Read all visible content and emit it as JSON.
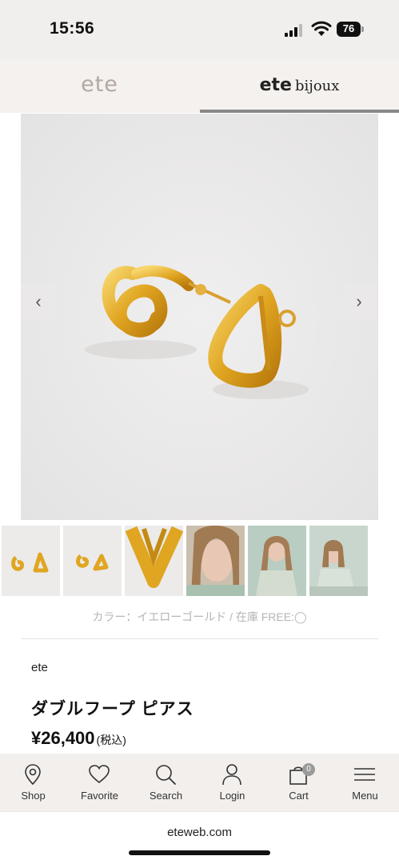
{
  "status": {
    "time": "15:56",
    "battery": "76"
  },
  "brand_tabs": [
    {
      "label": "ete"
    },
    {
      "label": "ete",
      "sub": "bijoux"
    }
  ],
  "carousel": {
    "prev_icon": "chevron-left-icon",
    "next_icon": "chevron-right-icon"
  },
  "variant_info": "カラー：イエローゴールド / 在庫 FREE:◯",
  "product": {
    "brand": "ete",
    "name": "ダブルフープ ピアス",
    "price": "¥26,400",
    "tax_label": "(税込)"
  },
  "nav": [
    {
      "label": "Shop",
      "icon": "map-pin-icon"
    },
    {
      "label": "Favorite",
      "icon": "heart-icon"
    },
    {
      "label": "Search",
      "icon": "search-icon"
    },
    {
      "label": "Login",
      "icon": "user-icon"
    },
    {
      "label": "Cart",
      "icon": "shopping-bag-icon",
      "badge": "0"
    },
    {
      "label": "Menu",
      "icon": "menu-icon"
    }
  ],
  "url": "eteweb.com",
  "colors": {
    "gold": "#e0a521",
    "tab_bg": "#f4f1ee",
    "nav_bg": "#f2efed"
  }
}
